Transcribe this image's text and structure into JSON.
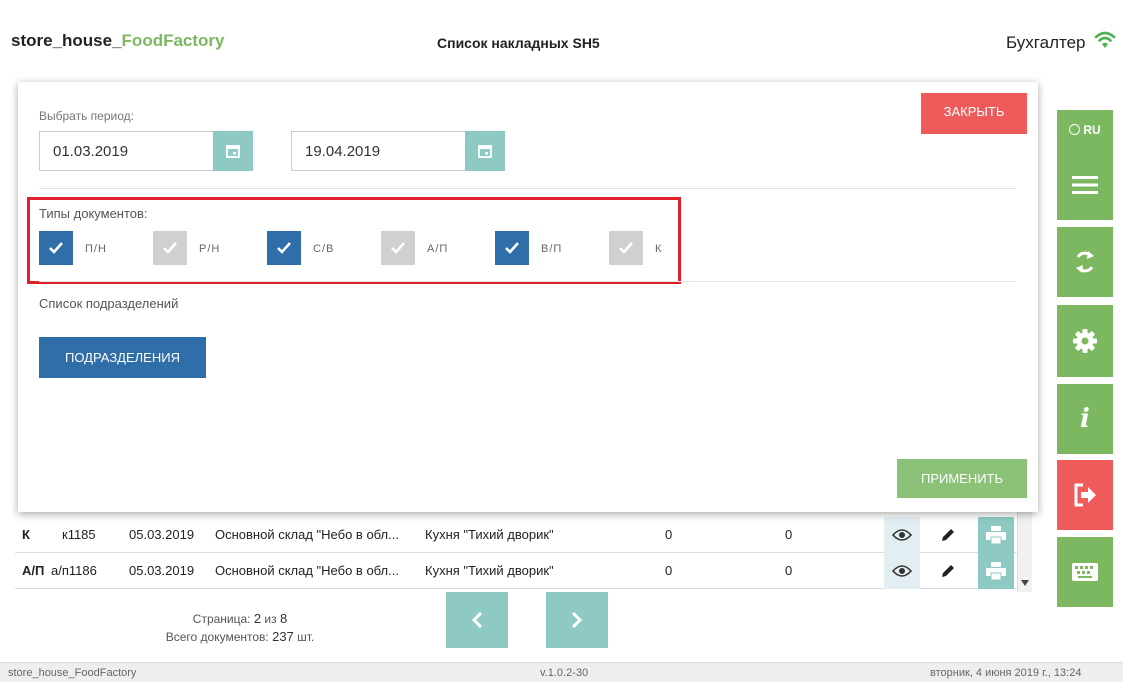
{
  "header": {
    "logo_prefix": "store_house_",
    "logo_suffix": "FoodFactory",
    "title": "Список накладных SH5",
    "role": "Бухгалтер",
    "wifi_icon": "wifi-icon"
  },
  "sidebar": {
    "lang": "RU",
    "items": [
      {
        "icon": "globe-icon",
        "label": "RU"
      },
      {
        "icon": "menu-icon"
      },
      {
        "icon": "sync-icon"
      },
      {
        "icon": "gear-icon"
      },
      {
        "icon": "info-icon"
      },
      {
        "icon": "logout-icon"
      },
      {
        "icon": "keyboard-icon"
      }
    ]
  },
  "filter": {
    "period_label": "Выбрать период:",
    "date_from": "01.03.2019",
    "date_to": "19.04.2019",
    "close_label": "ЗАКРЫТЬ",
    "types_label": "Типы документов:",
    "types": [
      {
        "label": "П/Н",
        "checked": true
      },
      {
        "label": "Р/Н",
        "checked": false
      },
      {
        "label": "С/В",
        "checked": true
      },
      {
        "label": "А/П",
        "checked": false
      },
      {
        "label": "В/П",
        "checked": true
      },
      {
        "label": "К",
        "checked": false
      }
    ],
    "subdiv_label": "Список подразделений",
    "subdiv_button": "ПОДРАЗДЕЛЕНИЯ",
    "apply_label": "ПРИМЕНИТЬ"
  },
  "table": {
    "rows": [
      {
        "type": "К",
        "number": "к1185",
        "date": "05.03.2019",
        "from": "Основной склад \"Небо в обл...",
        "to": "Кухня \"Тихий дворик\"",
        "v1": "0",
        "v2": "0"
      },
      {
        "type": "А/П",
        "number": "а/п1186",
        "date": "05.03.2019",
        "from": "Основной склад \"Небо в обл...",
        "to": "Кухня \"Тихий дворик\"",
        "v1": "0",
        "v2": "0"
      }
    ]
  },
  "pager": {
    "page_prefix": "Страница: ",
    "page_current": "2",
    "page_sep": " из ",
    "page_total": "8",
    "docs_prefix": "Всего документов: ",
    "docs_total": "237",
    "docs_suffix": " шт."
  },
  "footer": {
    "app": "store_house_FoodFactory",
    "version": "v.1.0.2-30",
    "datetime": "вторник, 4 июня 2019 г., 13:24"
  },
  "colors": {
    "green": "#7cb860",
    "teal": "#8ec9c3",
    "blue": "#2f6ea8",
    "red": "#ef5a5a",
    "highlight": "#e0202a"
  }
}
